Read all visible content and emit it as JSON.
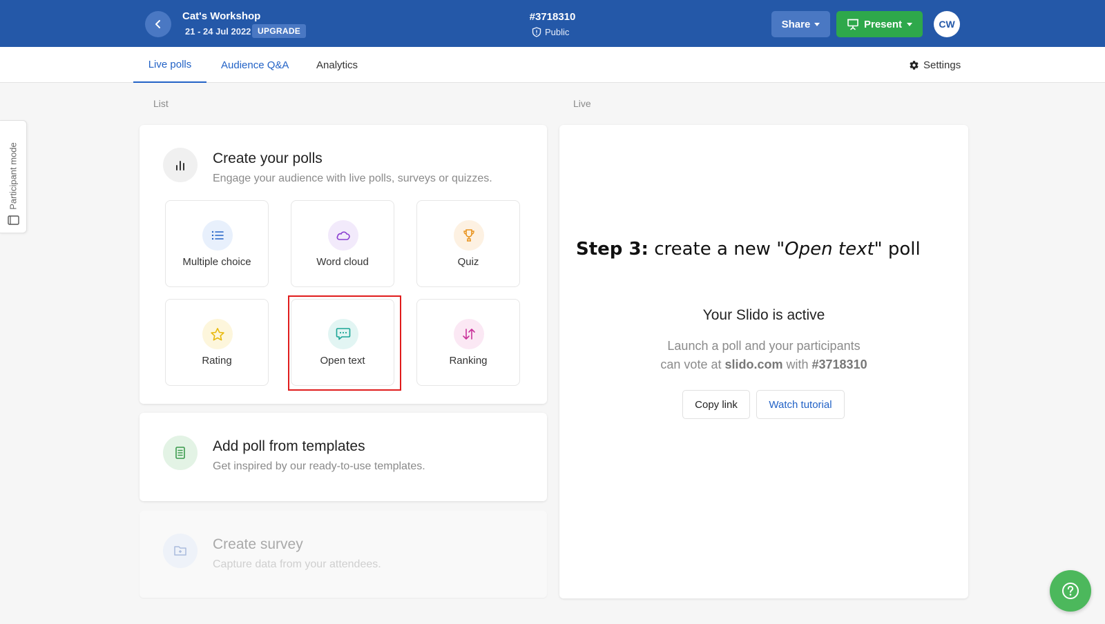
{
  "header": {
    "event_title": "Cat's Workshop",
    "event_dates": "21 - 24 Jul 2022",
    "upgrade_label": "UPGRADE",
    "event_code": "#3718310",
    "visibility": "Public",
    "share_label": "Share",
    "present_label": "Present",
    "avatar_initials": "CW"
  },
  "tabs": [
    {
      "label": "Live polls",
      "active": true
    },
    {
      "label": "Audience Q&A",
      "active": false
    },
    {
      "label": "Analytics",
      "active": false
    }
  ],
  "settings_label": "Settings",
  "participant_mode_label": "Participant mode",
  "sections": {
    "list": "List",
    "live": "Live"
  },
  "create_polls": {
    "title": "Create your polls",
    "subtitle": "Engage your audience with live polls, surveys or quizzes.",
    "poll_types": [
      {
        "label": "Multiple choice",
        "icon": "list-icon"
      },
      {
        "label": "Word cloud",
        "icon": "cloud-icon"
      },
      {
        "label": "Quiz",
        "icon": "trophy-icon"
      },
      {
        "label": "Rating",
        "icon": "star-icon"
      },
      {
        "label": "Open text",
        "icon": "chat-bubble-icon"
      },
      {
        "label": "Ranking",
        "icon": "sort-arrows-icon"
      }
    ]
  },
  "templates": {
    "title": "Add poll from templates",
    "subtitle": "Get inspired by our ready-to-use templates."
  },
  "survey": {
    "title": "Create survey",
    "subtitle": "Capture data from your attendees."
  },
  "live_panel": {
    "step_bold": "Step 3:",
    "step_text_1": " create a new ",
    "step_italic": "\"Open text\"",
    "step_text_2": " poll",
    "title": "Your Slido is active",
    "desc_line1": "Launch a poll and your participants",
    "desc_line2_prefix": "can vote at ",
    "desc_site": "slido.com",
    "desc_with": " with ",
    "desc_code": "#3718310",
    "copy_link_label": "Copy link",
    "watch_tutorial_label": "Watch tutorial"
  },
  "colors": {
    "header_bg": "#2458a8",
    "accent_blue": "#2262c6",
    "present_green": "#2ea84b",
    "help_green": "#4cb85c",
    "highlight_red": "#e01c1c"
  }
}
